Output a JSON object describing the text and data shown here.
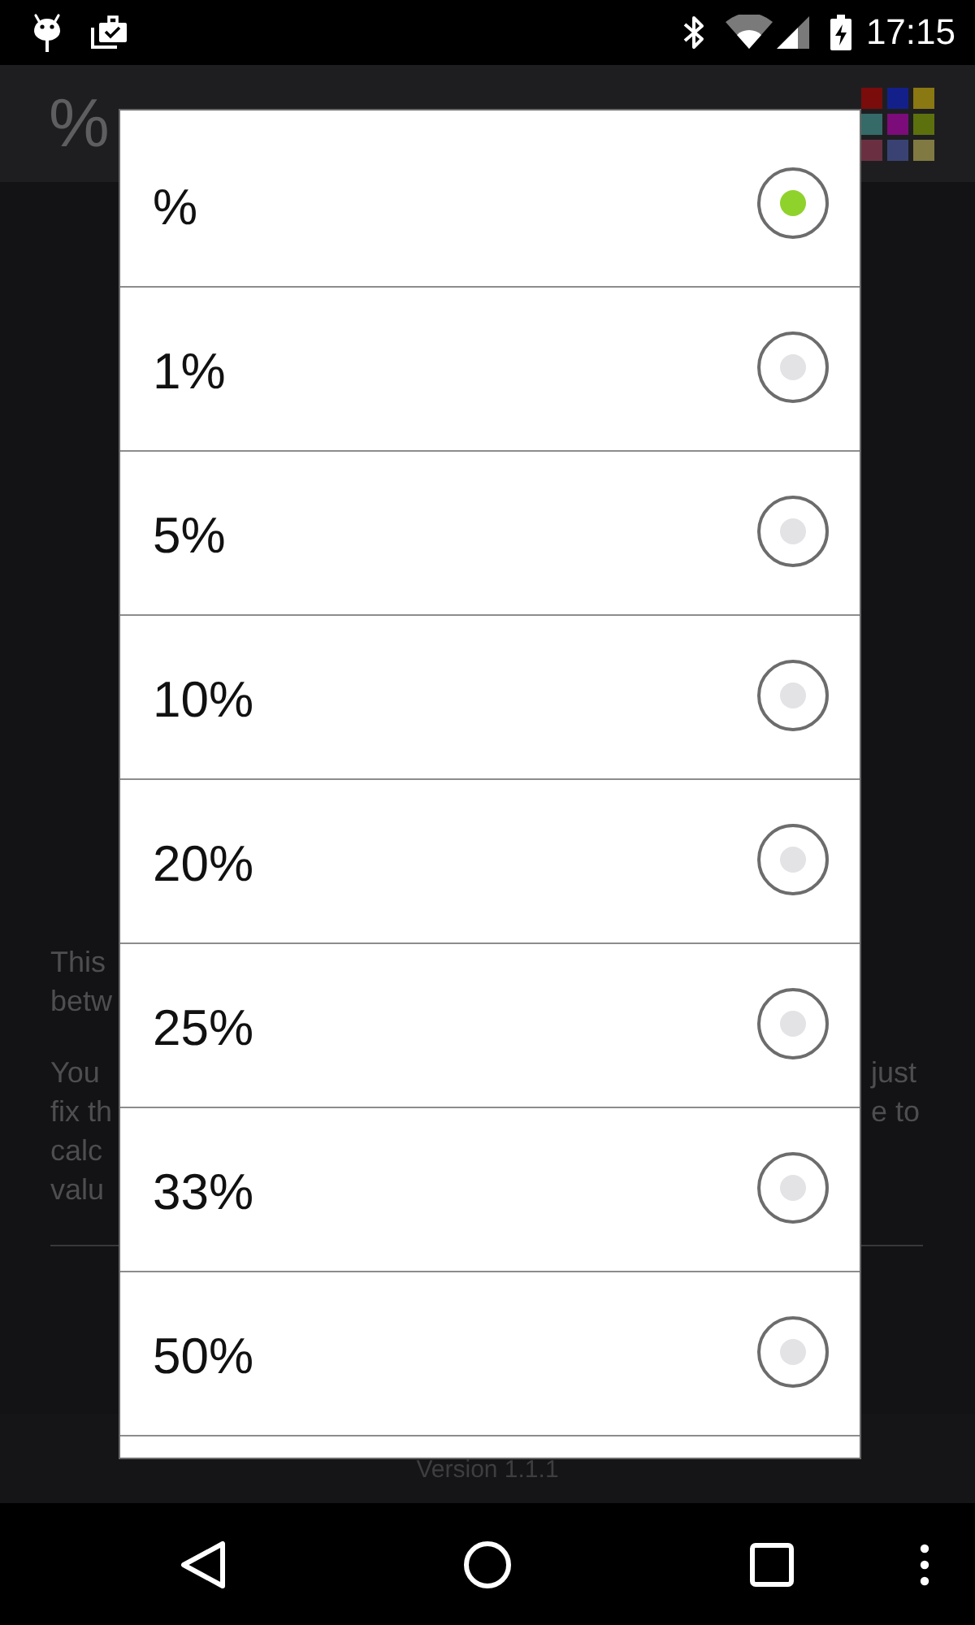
{
  "status_bar": {
    "time": "17:15"
  },
  "app_bar": {
    "logo": "%"
  },
  "body": {
    "paragraphs": [
      {
        "lines": [
          {
            "left": "This"
          },
          {
            "left": "betw"
          }
        ]
      },
      {
        "lines": [
          {
            "left": "You",
            "right": "just"
          },
          {
            "left": "fix th",
            "right": "e to"
          },
          {
            "left": "calc"
          },
          {
            "left": "valu"
          }
        ]
      }
    ]
  },
  "footer": {
    "version": "Version 1.1.1"
  },
  "dialog": {
    "options": [
      {
        "label": "%",
        "selected": true
      },
      {
        "label": "1%",
        "selected": false
      },
      {
        "label": "5%",
        "selected": false
      },
      {
        "label": "10%",
        "selected": false
      },
      {
        "label": "20%",
        "selected": false
      },
      {
        "label": "25%",
        "selected": false
      },
      {
        "label": "33%",
        "selected": false
      },
      {
        "label": "50%",
        "selected": false
      }
    ]
  }
}
